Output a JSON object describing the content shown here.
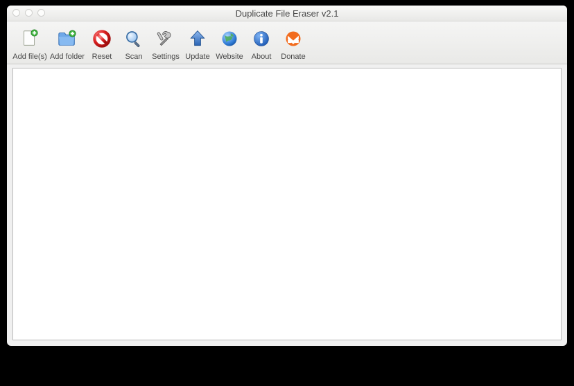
{
  "window": {
    "title": "Duplicate File Eraser v2.1"
  },
  "toolbar": {
    "items": [
      {
        "id": "add-files",
        "label": "Add file(s)",
        "icon": "file-plus-icon"
      },
      {
        "id": "add-folder",
        "label": "Add folder",
        "icon": "folder-plus-icon"
      },
      {
        "id": "reset",
        "label": "Reset",
        "icon": "no-entry-icon"
      },
      {
        "id": "scan",
        "label": "Scan",
        "icon": "search-icon"
      },
      {
        "id": "settings",
        "label": "Settings",
        "icon": "tools-icon"
      },
      {
        "id": "update",
        "label": "Update",
        "icon": "arrow-up-icon"
      },
      {
        "id": "website",
        "label": "Website",
        "icon": "globe-icon"
      },
      {
        "id": "about",
        "label": "About",
        "icon": "info-icon"
      },
      {
        "id": "donate",
        "label": "Donate",
        "icon": "donate-icon"
      }
    ]
  }
}
